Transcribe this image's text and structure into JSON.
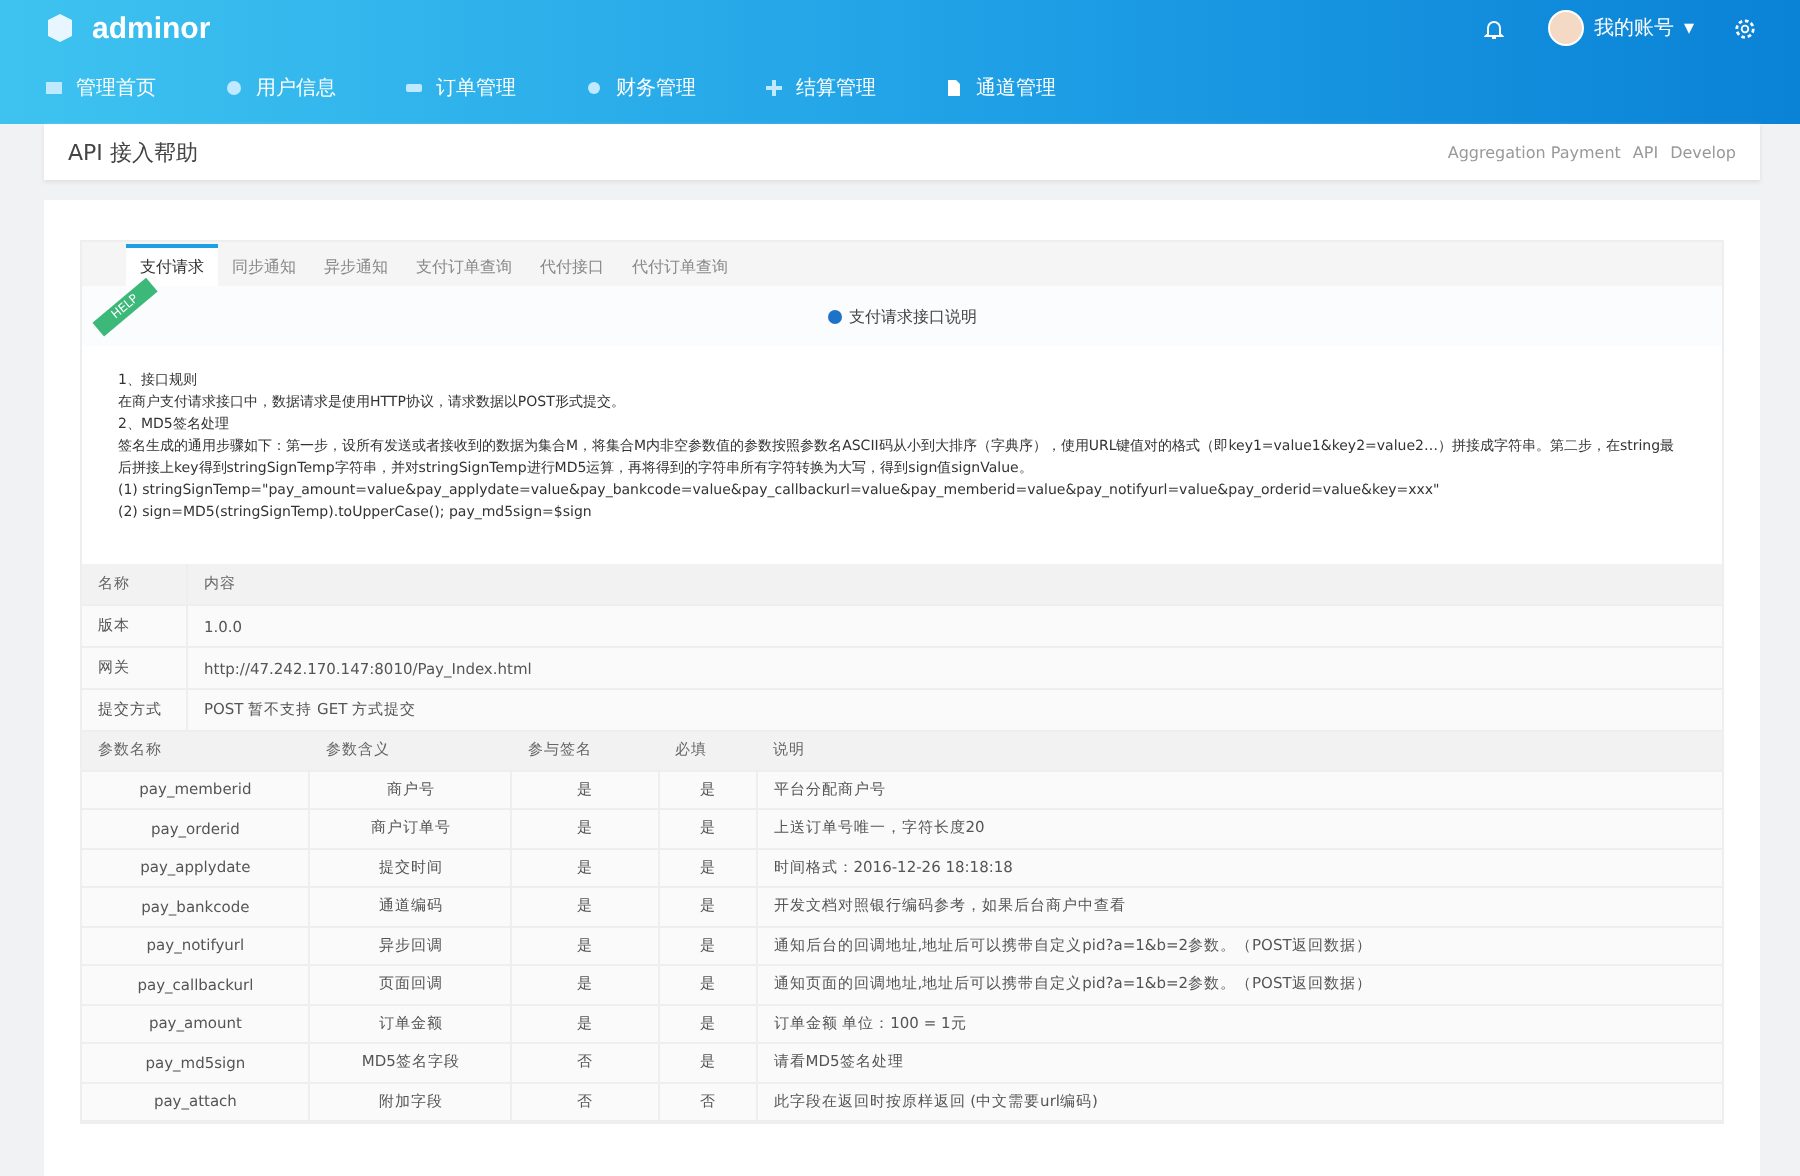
{
  "header": {
    "brand": "adminor",
    "user": {
      "name": "我的账号",
      "caret": "▾"
    },
    "nav": [
      {
        "label": "管理首页"
      },
      {
        "label": "用户信息"
      },
      {
        "label": "订单管理"
      },
      {
        "label": "财务管理"
      },
      {
        "label": "结算管理"
      },
      {
        "label": "通道管理"
      }
    ]
  },
  "page_title": "API 接入帮助",
  "breadcrumb": [
    "Aggregation Payment",
    "API",
    "Develop"
  ],
  "tabs": [
    {
      "label": "支付请求",
      "selected": true
    },
    {
      "label": "同步通知",
      "selected": false
    },
    {
      "label": "异步通知",
      "selected": false
    },
    {
      "label": "支付订单查询",
      "selected": false
    },
    {
      "label": "代付接口",
      "selected": false
    },
    {
      "label": "代付订单查询",
      "selected": false
    }
  ],
  "ribbon": "HELP",
  "notice": {
    "title": "支付请求接口说明",
    "lines": [
      "1、接口规则",
      "在商户支付请求接口中，数据请求是使用HTTP协议，请求数据以POST形式提交。",
      "2、MD5签名处理",
      "签名生成的通用步骤如下：第一步，设所有发送或者接收到的数据为集合M，将集合M内非空参数值的参数按照参数名ASCII码从小到大排序（字典序），使用URL键值对的格式（即key1=value1&key2=value2…）拼接成字符串。第二步，在string最后拼接上key得到stringSignTemp字符串，并对stringSignTemp进行MD5运算，再将得到的字符串所有字符转换为大写，得到sign值signValue。",
      "(1) stringSignTemp=\"pay_amount=value&pay_applydate=value&pay_bankcode=value&pay_callbackurl=value&pay_memberid=value&pay_notifyurl=value&pay_orderid=value&key=xxx\"",
      "(2) sign=MD5(stringSignTemp).toUpperCase(); pay_md5sign=$sign"
    ]
  },
  "info_table": {
    "columns": [
      "名称",
      "内容"
    ],
    "rows": [
      [
        "版本",
        "1.0.0"
      ],
      [
        "网关",
        "http://47.242.170.147:8010/Pay_Index.html"
      ],
      [
        "提交方式",
        "POST 暂不支持 GET 方式提交"
      ]
    ]
  },
  "param_table": {
    "columns": [
      "参数名称",
      "参数含义",
      "参与签名",
      "必填",
      "说明"
    ],
    "rows": [
      [
        "pay_memberid",
        "商户号",
        "是",
        "是",
        "平台分配商户号"
      ],
      [
        "pay_orderid",
        "商户订单号",
        "是",
        "是",
        "上送订单号唯一，字符长度20"
      ],
      [
        "pay_applydate",
        "提交时间",
        "是",
        "是",
        "时间格式：2016-12-26 18:18:18"
      ],
      [
        "pay_bankcode",
        "通道编码",
        "是",
        "是",
        "开发文档对照银行编码参考，如果后台商户中查看"
      ],
      [
        "pay_notifyurl",
        "异步回调",
        "是",
        "是",
        "通知后台的回调地址,地址后可以携带自定义pid?a=1&b=2参数。（POST返回数据）"
      ],
      [
        "pay_callbackurl",
        "页面回调",
        "是",
        "是",
        "通知页面的回调地址,地址后可以携带自定义pid?a=1&b=2参数。（POST返回数据）"
      ],
      [
        "pay_amount",
        "订单金额",
        "是",
        "是",
        "订单金额 单位：100 = 1元"
      ],
      [
        "pay_md5sign",
        "MD5签名字段",
        "否",
        "是",
        "请看MD5签名处理"
      ],
      [
        "pay_attach",
        "附加字段",
        "否",
        "否",
        "此字段在返回时按原样返回 (中文需要url编码)"
      ]
    ]
  }
}
